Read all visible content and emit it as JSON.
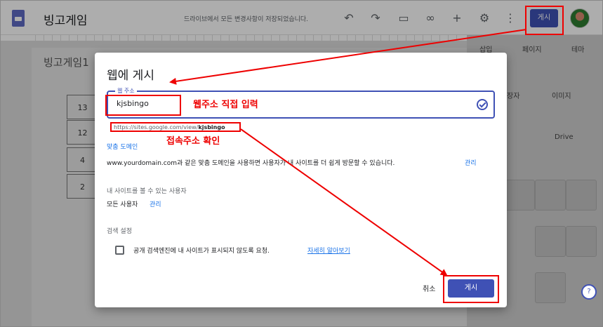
{
  "topbar": {
    "site_name": "빙고게임",
    "save_status": "드라이브에서 모든 변경사항이 저장되었습니다.",
    "publish_label": "게시"
  },
  "background": {
    "page_title": "빙고게임1",
    "cells": [
      "13",
      "12",
      "4",
      "2"
    ]
  },
  "right_panel": {
    "tabs": [
      "삽입",
      "페이지",
      "테마"
    ],
    "items": [
      "장자",
      "이미지",
      "Drive"
    ]
  },
  "dialog": {
    "title": "웹에 게시",
    "address_label": "웹 주소",
    "address_value": "kjsbingo",
    "url_prefix": "https://sites.google.com/view/",
    "url_suffix": "kjsbingo",
    "custom_domain_link": "맞춤 도메인",
    "custom_domain_desc": "www.yourdomain.com과 같은 맞춤 도메인을 사용하면 사용자가 내 사이트를 더 쉽게 방문할 수 있습니다.",
    "manage_label": "관리",
    "viewers_label": "내 사이트를 볼 수 있는 사용자",
    "viewers_value": "모든 사용자",
    "search_label": "검색 설정",
    "search_checkbox_text": "공개 검색엔진에 내 사이트가 표시되지 않도록 요청.",
    "learn_more": "자세히 알아보기",
    "cancel_label": "취소",
    "publish_label": "게시"
  },
  "annotations": {
    "enter_address": "웹주소 직접 입력",
    "check_address": "접속주소 확인"
  },
  "colors": {
    "accent": "#3f51b5",
    "annotation": "#ee0000",
    "link": "#1a73e8"
  }
}
